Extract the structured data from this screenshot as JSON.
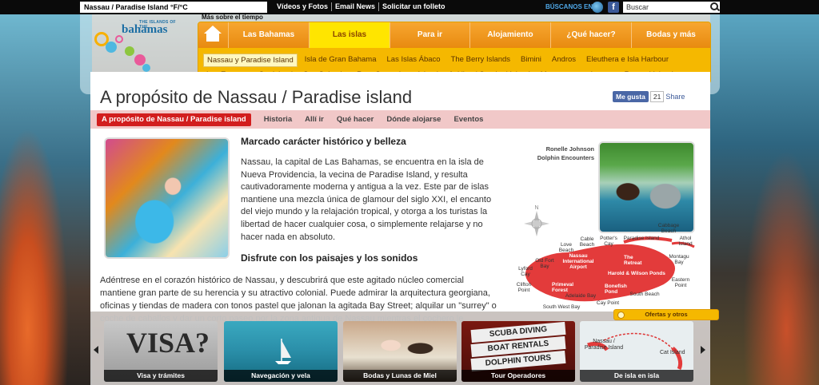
{
  "topbar": {
    "weather": "Nassau / Paradise Island °F/°C",
    "links": [
      "Vídeos y Fotos",
      "Email News",
      "Solicitar un folleto"
    ],
    "find_us": "BÚSCANOS EN",
    "search_placeholder": "Buscar"
  },
  "header": {
    "logo_top": "THE ISLANDS OF THE",
    "logo_text": "bahamas",
    "more_weather": "Más sobre el tiempo"
  },
  "nav": {
    "main": [
      "Las Bahamas",
      "Las islas",
      "Para ir",
      "Alojamiento",
      "¿Qué hacer?",
      "Bodas y más"
    ],
    "main_active": 1,
    "sub": [
      "Nassau y Paradise Island",
      "Isla de Gran Bahama",
      "Las Islas Ábaco",
      "The Berry Islands",
      "Bimini",
      "Andros",
      "Eleuthera e Isla Harbour",
      "Las Exumas",
      "Cat Island",
      "San Salvador y Rum Cay",
      "Long Island",
      "Acklins / Crooked Island",
      "Mayaguana",
      "Inagua",
      "Ragged Island"
    ],
    "sub_active": 0
  },
  "page": {
    "title": "A propósito de Nassau / Paradise island",
    "like_label": "Me gusta",
    "like_count": "21",
    "share": "Share",
    "tabs": [
      "A propósito de Nassau / Paradise island",
      "Historia",
      "Allí ir",
      "Qué hacer",
      "Dónde alojarse",
      "Eventos"
    ],
    "tab_active": 0
  },
  "article": {
    "heading1": "Marcado carácter histórico y belleza",
    "para1": "Nassau, la capital de Las Bahamas, se encuentra en la isla de Nueva Providencia, la vecina de Paradise Island, y resulta cautivadoramente moderna y antigua a la vez. Este par de islas mantiene una mezcla única de glamour del siglo XXI, el encanto del viejo mundo y la relajación tropical, y otorga a los turistas la libertad de hacer cualquier cosa, o simplemente relajarse y no hacer nada en absoluto.",
    "heading2": "Disfrute con los paisajes y los sonidos",
    "para2": "Adéntrese en el corazón histórico de Nassau, y descubrirá que este agitado núcleo comercial mantiene gran parte de su herencia y su atractivo colonial. Puede admirar la arquitectura georgiana, oficinas y tiendas de madera con tonos pastel que jalonan la agitada Bay Street; alquilar un \"surrey\" o coche de caballos y dar un corto paseo por la zona antigua de Nassau mientras el cochero le"
  },
  "sidebar": {
    "caption_name": "Ronelle Johnson",
    "caption_org": "Dolphin Encounters",
    "compass_label": "N"
  },
  "map": {
    "labels": [
      "Cabbage Beach",
      "Cable Beach",
      "Potter's Cay",
      "Paradise Island",
      "Athol Island",
      "Love Beach",
      "Montagu Bay",
      "Old Fort Bay",
      "Nassau International Airport",
      "The Retreat",
      "Lyford Cay",
      "Harold & Wilson Ponds",
      "Eastern Point",
      "Clifton Point",
      "Primeval Forest",
      "Bonefish Pond",
      "Adelaide Bay",
      "South Beach",
      "Cay Point",
      "South West Bay"
    ]
  },
  "carousel": {
    "offers_label": "Ofertas y otros",
    "cards": [
      "Visa y trámites",
      "Navegación y vela",
      "Bodas y Lunas de Miel",
      "Tour Operadores",
      "De isla en isla"
    ],
    "visa_text": "VISA?",
    "signs": [
      "SCUBA DIVING",
      "BOAT RENTALS",
      "DOLPHIN TOURS"
    ],
    "mini_map_labels": [
      "Nassau / Paradise Island",
      "Cat Island"
    ]
  },
  "colors": {
    "accent_orange": "#f5b800",
    "tab_red": "#d21e1e",
    "nav_orange": "#e88a10"
  }
}
